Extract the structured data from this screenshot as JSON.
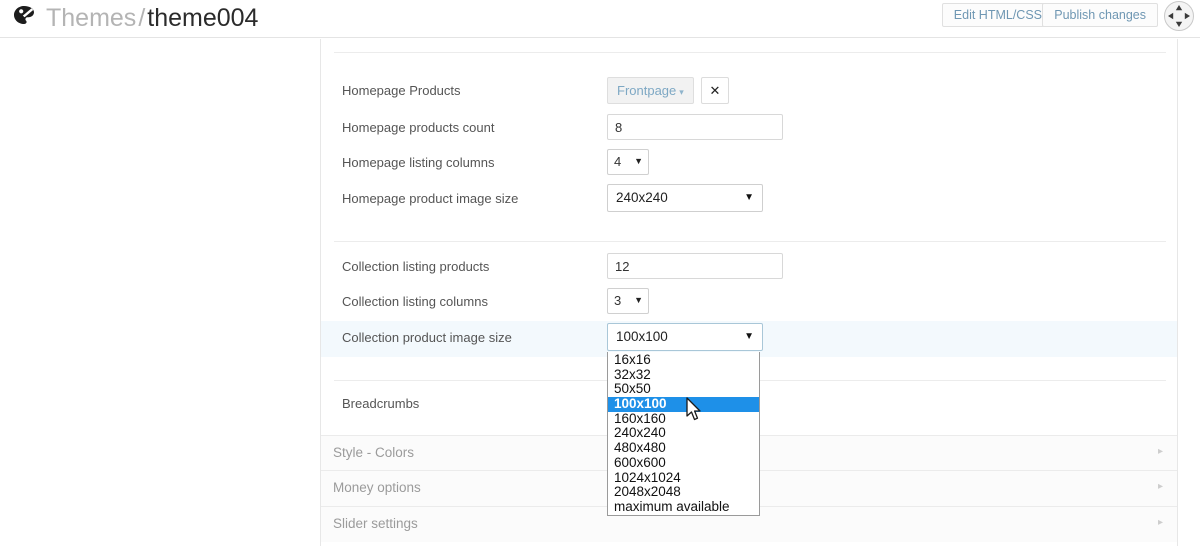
{
  "header": {
    "logo_icon": "palette-icon",
    "breadcrumb_parent": "Themes",
    "breadcrumb_separator": "/",
    "breadcrumb_current": "theme004",
    "edit_html_label": "Edit HTML/CSS",
    "publish_label": "Publish changes",
    "move_handle_icon": "four-arrows-move-icon"
  },
  "form": {
    "section_one": [
      {
        "label": "Homepage Products",
        "control": "picker",
        "value": "Frontpage",
        "caret": "▾",
        "clear_label": "✕"
      },
      {
        "label": "Homepage products count",
        "control": "text",
        "value": "8",
        "placeholder": ""
      },
      {
        "label": "Homepage listing columns",
        "control": "select-small",
        "value": "4",
        "caret": "▼"
      },
      {
        "label": "Homepage product image size",
        "control": "select-wide",
        "value": "240x240",
        "caret": "▼"
      }
    ],
    "section_two": [
      {
        "label": "Collection listing products",
        "control": "text",
        "value": "12",
        "placeholder": ""
      },
      {
        "label": "Collection listing columns",
        "control": "select-small",
        "value": "3",
        "caret": "▼"
      },
      {
        "label": "Collection product image size",
        "control": "select-wide",
        "value": "100x100",
        "caret": "▼",
        "highlighted": true,
        "expanded": true
      }
    ],
    "section_three": [
      {
        "label": "Breadcrumbs",
        "control": "none"
      }
    ]
  },
  "image_size_options": [
    "16x16",
    "32x32",
    "50x50",
    "100x100",
    "160x160",
    "240x240",
    "480x480",
    "600x600",
    "1024x1024",
    "2048x2048",
    "maximum available"
  ],
  "image_size_selected": "100x100",
  "accordion": [
    {
      "label": "Style - Colors",
      "chevron": "▸"
    },
    {
      "label": "Money options",
      "chevron": "▸"
    },
    {
      "label": "Slider settings",
      "chevron": "▸"
    }
  ],
  "colors": {
    "dropdown_selected_bg": "#1e90e8",
    "row_highlight_bg": "#f3f9fd",
    "link_blue": "#7ea8c4",
    "muted_text": "#9b9b9b"
  }
}
